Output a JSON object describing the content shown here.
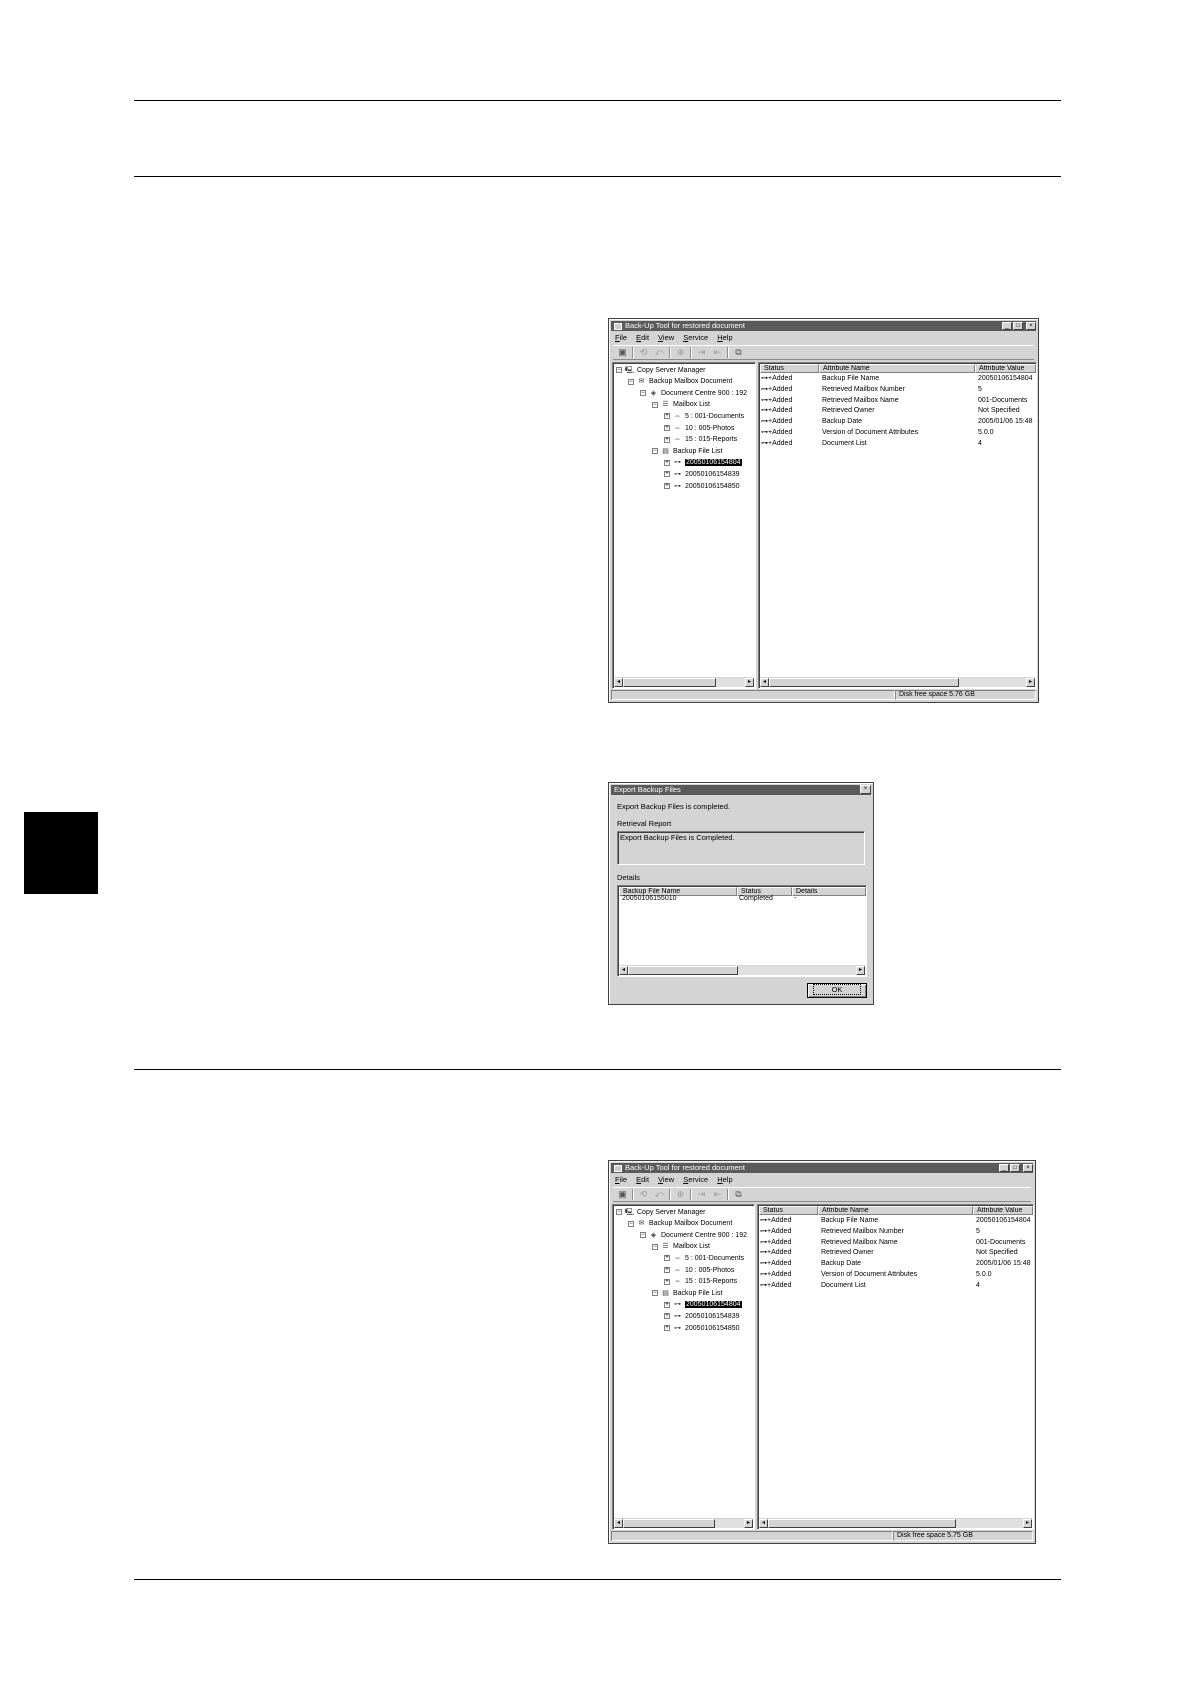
{
  "windows": [
    {
      "title": "Back-Up Tool for restored document",
      "menu": [
        "File",
        "Edit",
        "View",
        "Service",
        "Help"
      ],
      "tree": [
        {
          "level": 0,
          "toggle": "−",
          "icon": "server",
          "label": "Copy Server Manager"
        },
        {
          "level": 1,
          "toggle": "−",
          "icon": "mailbox",
          "label": "Backup Mailbox Document"
        },
        {
          "level": 2,
          "toggle": "−",
          "icon": "device",
          "label": "Document Centre 900 : 192"
        },
        {
          "level": 3,
          "toggle": "−",
          "icon": "list",
          "label": "Mailbox List"
        },
        {
          "level": 4,
          "toggle": "+",
          "icon": "box",
          "label": "5 : 001-Documents"
        },
        {
          "level": 4,
          "toggle": "+",
          "icon": "box",
          "label": "10 : 005-Photos"
        },
        {
          "level": 4,
          "toggle": "+",
          "icon": "box",
          "label": "15 : 015-Reports"
        },
        {
          "level": 3,
          "toggle": "−",
          "icon": "files",
          "label": "Backup File List"
        },
        {
          "level": 4,
          "toggle": "+",
          "icon": "file",
          "label": "20050106154804",
          "selected": true
        },
        {
          "level": 4,
          "toggle": "+",
          "icon": "file",
          "label": "20050106154839"
        },
        {
          "level": 4,
          "toggle": "+",
          "icon": "file",
          "label": "20050106154850"
        }
      ],
      "columns": [
        "Status",
        "Attribute Name",
        "Attribute Value"
      ],
      "rows": [
        [
          "Added",
          "Backup File Name",
          "20050106154804"
        ],
        [
          "Added",
          "Retrieved Mailbox Number",
          "5"
        ],
        [
          "Added",
          "Retrieved Mailbox Name",
          "001-Documents"
        ],
        [
          "Added",
          "Retrieved Owner",
          "Not Specified"
        ],
        [
          "Added",
          "Backup Date",
          "2005/01/06 15:48"
        ],
        [
          "Added",
          "Version of Document Attributes",
          "5.0.0"
        ],
        [
          "Added",
          "Document List",
          "4"
        ]
      ],
      "status": "Disk free space 5.76 GB"
    },
    {
      "title": "Back-Up Tool for restored document",
      "menu": [
        "File",
        "Edit",
        "View",
        "Service",
        "Help"
      ],
      "tree": [
        {
          "level": 0,
          "toggle": "−",
          "icon": "server",
          "label": "Copy Server Manager"
        },
        {
          "level": 1,
          "toggle": "−",
          "icon": "mailbox",
          "label": "Backup Mailbox Document"
        },
        {
          "level": 2,
          "toggle": "−",
          "icon": "device",
          "label": "Document Centre 900 : 192"
        },
        {
          "level": 3,
          "toggle": "−",
          "icon": "list",
          "label": "Mailbox List"
        },
        {
          "level": 4,
          "toggle": "+",
          "icon": "box",
          "label": "5 : 001-Documents"
        },
        {
          "level": 4,
          "toggle": "+",
          "icon": "box",
          "label": "10 : 005-Photos"
        },
        {
          "level": 4,
          "toggle": "+",
          "icon": "box",
          "label": "15 : 015-Reports"
        },
        {
          "level": 3,
          "toggle": "−",
          "icon": "files",
          "label": "Backup File List"
        },
        {
          "level": 4,
          "toggle": "+",
          "icon": "file",
          "label": "20050106154804",
          "selected": true
        },
        {
          "level": 4,
          "toggle": "+",
          "icon": "file",
          "label": "20050106154839"
        },
        {
          "level": 4,
          "toggle": "+",
          "icon": "file",
          "label": "20050106154850"
        }
      ],
      "columns": [
        "Status",
        "Attribute Name",
        "Attribute Value"
      ],
      "rows": [
        [
          "Added",
          "Backup File Name",
          "20050106154804"
        ],
        [
          "Added",
          "Retrieved Mailbox Number",
          "5"
        ],
        [
          "Added",
          "Retrieved Mailbox Name",
          "001-Documents"
        ],
        [
          "Added",
          "Retrieved Owner",
          "Not Specified"
        ],
        [
          "Added",
          "Backup Date",
          "2005/01/06 15:48"
        ],
        [
          "Added",
          "Version of Document Attributes",
          "5.0.0"
        ],
        [
          "Added",
          "Document List",
          "4"
        ]
      ],
      "status": "Disk free space 5.75 GB"
    }
  ],
  "dialog": {
    "title": "Export Backup Files",
    "message": "Export Backup Files is completed.",
    "report_label": "Retrieval Report",
    "report_text": "Export Backup Files is Completed.",
    "details_label": "Details",
    "columns": [
      "Backup File Name",
      "Status",
      "Details"
    ],
    "rows": [
      [
        "20050106155010",
        "Completed",
        "-"
      ]
    ],
    "ok_label": "OK"
  },
  "icons": {
    "close": "×",
    "minimize": "_",
    "maximize": "□",
    "scroll_left": "◂",
    "scroll_right": "▸"
  }
}
